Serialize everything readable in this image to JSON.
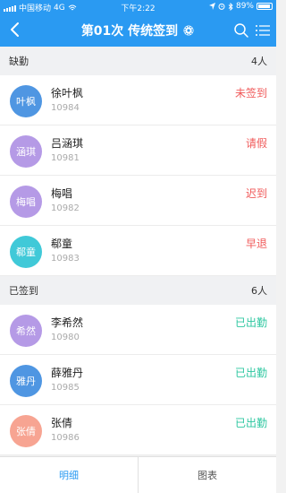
{
  "status_bar": {
    "carrier": "中国移动",
    "network": "4G",
    "time": "下午2:22",
    "battery": "89%"
  },
  "nav": {
    "title": "第01次 传统签到"
  },
  "colors": {
    "brand": "#2a9af2",
    "status_red": "#f05a5a",
    "status_green": "#2dc7a0",
    "tab_active": "#2a9af2"
  },
  "sections": [
    {
      "title": "缺勤",
      "count": "4人",
      "rows": [
        {
          "avatar": "叶枫",
          "name": "徐叶枫",
          "id": "10984",
          "status": "未签到",
          "avatar_color": "#4f96e2",
          "status_color": "#f05a5a"
        },
        {
          "avatar": "涵琪",
          "name": "吕涵琪",
          "id": "10981",
          "status": "请假",
          "avatar_color": "#b59ae6",
          "status_color": "#f05a5a"
        },
        {
          "avatar": "梅唱",
          "name": "梅唱",
          "id": "10982",
          "status": "迟到",
          "avatar_color": "#b59ae6",
          "status_color": "#f05a5a"
        },
        {
          "avatar": "郗童",
          "name": "郗童",
          "id": "10983",
          "status": "早退",
          "avatar_color": "#40c9d8",
          "status_color": "#f05a5a"
        }
      ]
    },
    {
      "title": "已签到",
      "count": "6人",
      "rows": [
        {
          "avatar": "希然",
          "name": "李希然",
          "id": "10980",
          "status": "已出勤",
          "avatar_color": "#b59ae6",
          "status_color": "#2dc7a0"
        },
        {
          "avatar": "雅丹",
          "name": "薛雅丹",
          "id": "10985",
          "status": "已出勤",
          "avatar_color": "#4f96e2",
          "status_color": "#2dc7a0"
        },
        {
          "avatar": "张倩",
          "name": "张倩",
          "id": "10986",
          "status": "已出勤",
          "avatar_color": "#f7a492",
          "status_color": "#2dc7a0"
        }
      ]
    }
  ],
  "bottom_tabs": [
    {
      "label": "明细",
      "active": true
    },
    {
      "label": "图表",
      "active": false
    }
  ]
}
